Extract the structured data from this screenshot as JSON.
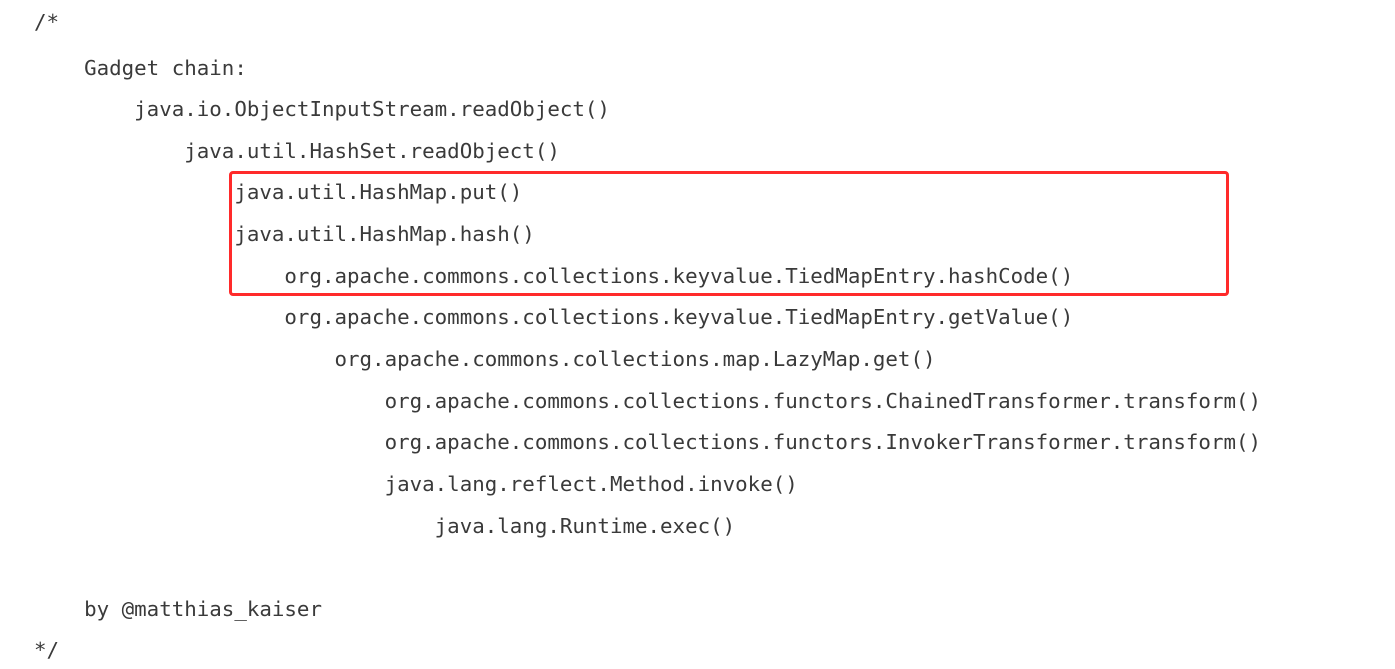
{
  "code": {
    "lines": [
      "/*",
      "    Gadget chain:",
      "        java.io.ObjectInputStream.readObject()",
      "            java.util.HashSet.readObject()",
      "                java.util.HashMap.put()",
      "                java.util.HashMap.hash()",
      "                    org.apache.commons.collections.keyvalue.TiedMapEntry.hashCode()",
      "                    org.apache.commons.collections.keyvalue.TiedMapEntry.getValue()",
      "                        org.apache.commons.collections.map.LazyMap.get()",
      "                            org.apache.commons.collections.functors.ChainedTransformer.transform()",
      "                            org.apache.commons.collections.functors.InvokerTransformer.transform()",
      "                            java.lang.reflect.Method.invoke()",
      "                                java.lang.Runtime.exec()",
      "",
      "    by @matthias_kaiser",
      "*/"
    ],
    "highlight_color": "#ff2a2a"
  }
}
